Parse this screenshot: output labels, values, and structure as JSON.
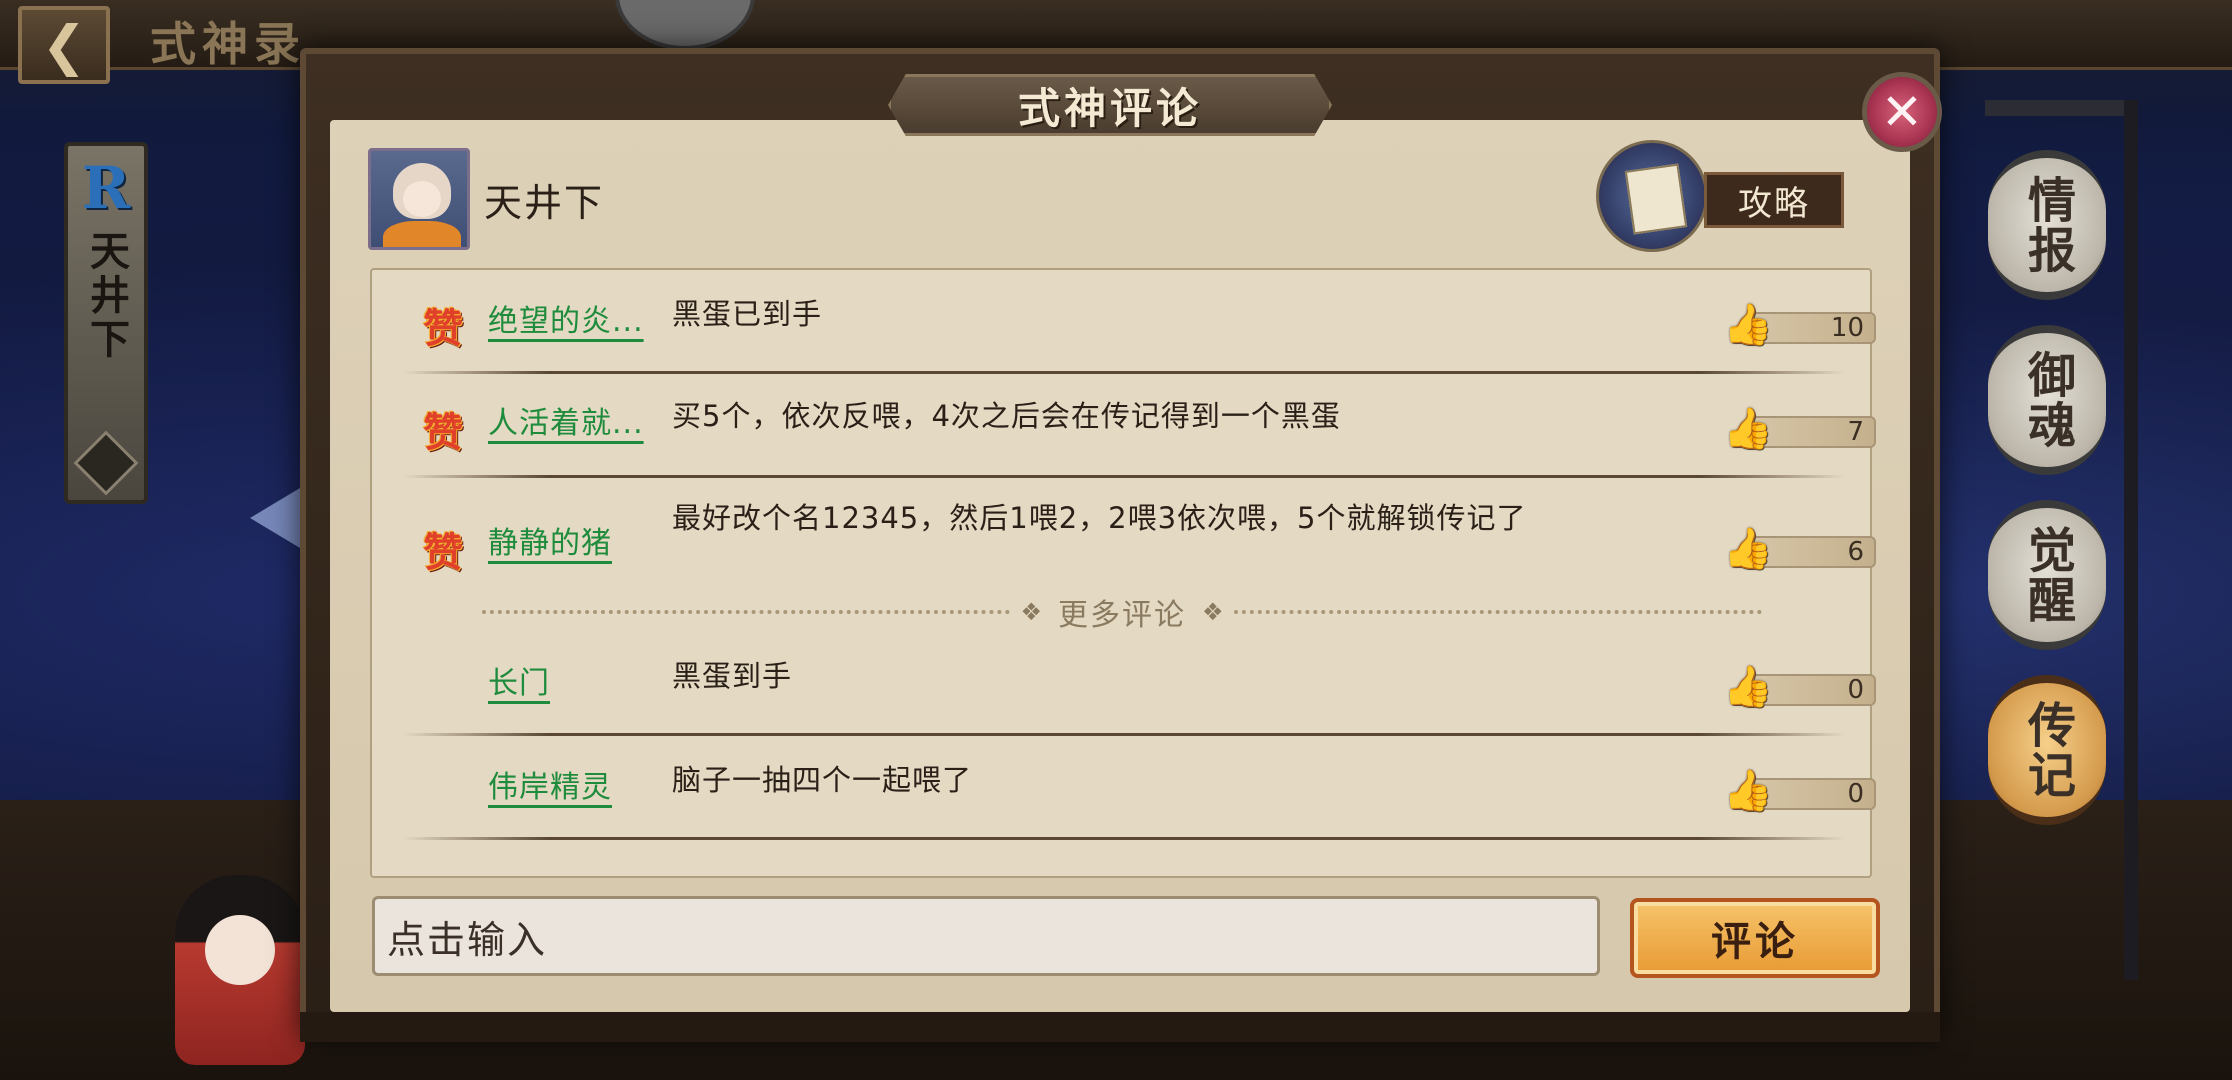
{
  "background": {
    "page_title": "式神录",
    "back_icon": "chevron-left-icon",
    "left_card": {
      "rarity": "R",
      "name": "天井下"
    },
    "side_tabs": [
      "情报",
      "御魂",
      "觉醒",
      "传记"
    ],
    "active_tab": "传记"
  },
  "dialog": {
    "title": "式神评论",
    "close_icon": "close-icon",
    "shikigami_name": "天井下",
    "guide_label": "攻略",
    "hot_badge": "赞",
    "more_comments": "更多评论",
    "hot_comments": [
      {
        "user": "绝望的炎...",
        "text": "黑蛋已到手",
        "likes": "10"
      },
      {
        "user": "人活着就...",
        "text": "买5个，依次反喂，4次之后会在传记得到一个黑蛋",
        "likes": "7"
      },
      {
        "user": "静静的猪",
        "text": "最好改个名12345，然后1喂2，2喂3依次喂，5个就解锁传记了",
        "likes": "6"
      }
    ],
    "comments": [
      {
        "user": "长门",
        "text": "黑蛋到手",
        "likes": "0"
      },
      {
        "user": "伟岸精灵",
        "text": "脑子一抽四个一起喂了",
        "likes": "0"
      }
    ],
    "input_placeholder": "点击输入",
    "submit_label": "评论"
  },
  "colors": {
    "username": "#1e8c3c",
    "hot_badge": "#e0402a",
    "submit_button": "#e89a34",
    "close_button": "#a83452"
  }
}
